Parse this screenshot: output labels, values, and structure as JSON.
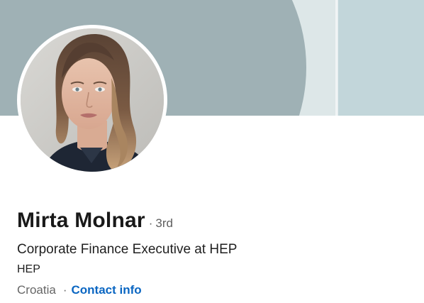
{
  "profile": {
    "name": "Mirta Molnar",
    "degree_separator": "·",
    "degree": "3rd",
    "headline": "Corporate Finance Executive at HEP",
    "company": "HEP",
    "location": "Croatia",
    "location_separator": "·",
    "contact_label": "Contact info"
  },
  "colors": {
    "banner_base": "#c2d6da",
    "banner_shape": "#9fb1b5",
    "banner_band": "#dde7e8",
    "link": "#0a66c2",
    "name_text": "#191919",
    "muted_text": "#666666"
  }
}
